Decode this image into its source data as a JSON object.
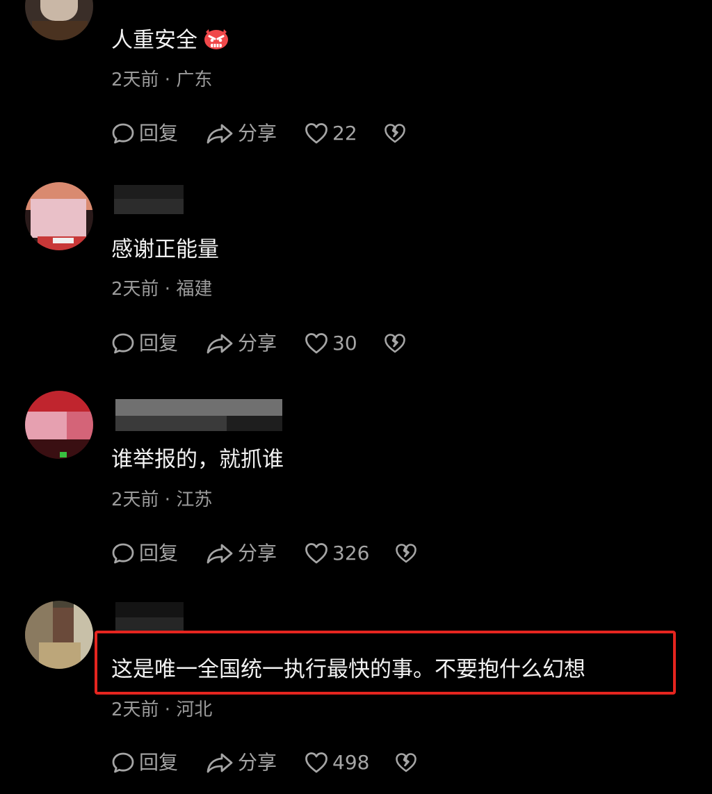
{
  "comments": [
    {
      "text": "人重安全",
      "meta": "2天前 · 广东",
      "reply_label": "回复",
      "share_label": "分享",
      "likes": "22",
      "has_angry_emoji": true
    },
    {
      "text": "感谢正能量",
      "meta": "2天前 · 福建",
      "reply_label": "回复",
      "share_label": "分享",
      "likes": "30"
    },
    {
      "text": "谁举报的，就抓谁",
      "meta": "2天前 · 江苏",
      "reply_label": "回复",
      "share_label": "分享",
      "likes": "326"
    },
    {
      "text": "这是唯一全国统一执行最快的事。不要抱什么幻想",
      "meta": "2天前 · 河北",
      "reply_label": "回复",
      "share_label": "分享",
      "likes": "498",
      "highlighted": true
    }
  ],
  "colors": {
    "background": "#000000",
    "highlight_border": "#e5251f",
    "meta_text": "#9b9b9b",
    "action_text": "#a5a5a5"
  },
  "icons": {
    "reply": "speech-bubble-icon",
    "share": "share-arrow-icon",
    "like": "heart-outline-icon",
    "dislike": "broken-heart-icon",
    "emoji": "angry-face-emoji"
  }
}
